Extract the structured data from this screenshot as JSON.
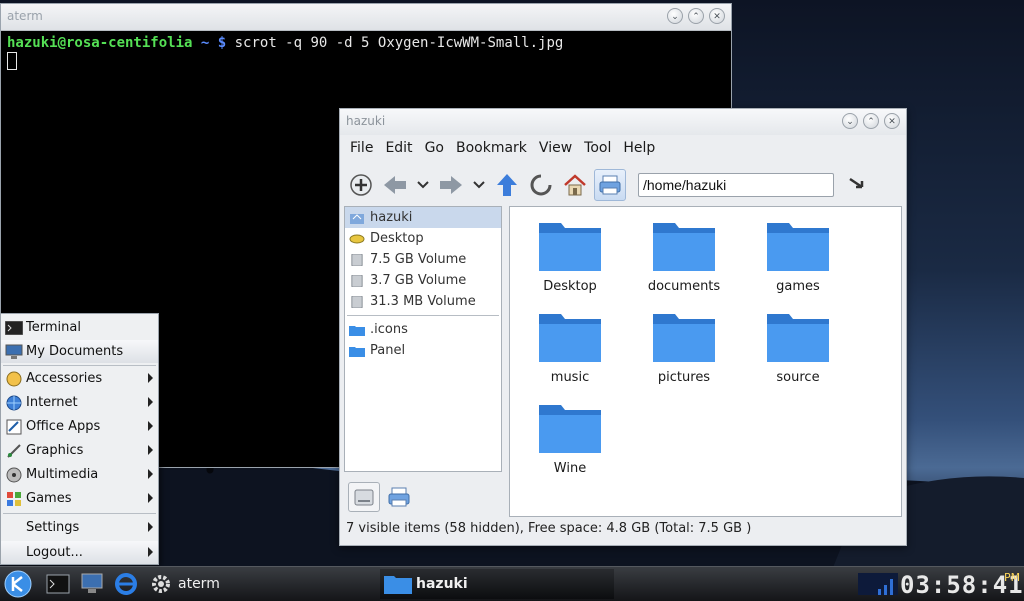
{
  "aterm": {
    "title": "aterm",
    "prompt_user": "hazuki@rosa-centifolia",
    "prompt_path": "~ $",
    "command": "scrot -q 90 -d 5 Oxygen-IcwWM-Small.jpg"
  },
  "filemanager": {
    "title": "hazuki",
    "menu": [
      "File",
      "Edit",
      "Go",
      "Bookmark",
      "View",
      "Tool",
      "Help"
    ],
    "path": "/home/hazuki",
    "places": [
      {
        "label": "hazuki",
        "icon": "home-icon"
      },
      {
        "label": "Desktop",
        "icon": "desktop-icon"
      },
      {
        "label": "7.5 GB Volume",
        "icon": "drive-icon"
      },
      {
        "label": "3.7 GB Volume",
        "icon": "drive-icon"
      },
      {
        "label": "31.3 MB Volume",
        "icon": "drive-icon"
      }
    ],
    "bookmarks": [
      {
        "label": ".icons",
        "icon": "folder-icon"
      },
      {
        "label": "Panel",
        "icon": "folder-icon"
      }
    ],
    "folders": [
      "Desktop",
      "documents",
      "games",
      "music",
      "pictures",
      "source",
      "Wine"
    ],
    "status": "7 visible items (58 hidden), Free space: 4.8 GB (Total: 7.5 GB )"
  },
  "startmenu": {
    "items": [
      {
        "label": "Terminal"
      },
      {
        "label": "My Documents"
      },
      {
        "label": "Accessories"
      },
      {
        "label": "Internet"
      },
      {
        "label": "Office Apps"
      },
      {
        "label": "Graphics"
      },
      {
        "label": "Multimedia"
      },
      {
        "label": "Games"
      },
      {
        "label": "Settings"
      },
      {
        "label": "Logout..."
      }
    ]
  },
  "taskbar": {
    "tasks": [
      {
        "label": "aterm",
        "icon": "gear-icon"
      },
      {
        "label": "hazuki",
        "icon": "folder-icon"
      }
    ],
    "clock": "03:58:41",
    "ampm": "PM"
  },
  "colors": {
    "folder_blue": "#3a8ee6",
    "prompt_user": "#55e055",
    "prompt_path": "#5b8cff",
    "ampm": "#ffd85a"
  }
}
